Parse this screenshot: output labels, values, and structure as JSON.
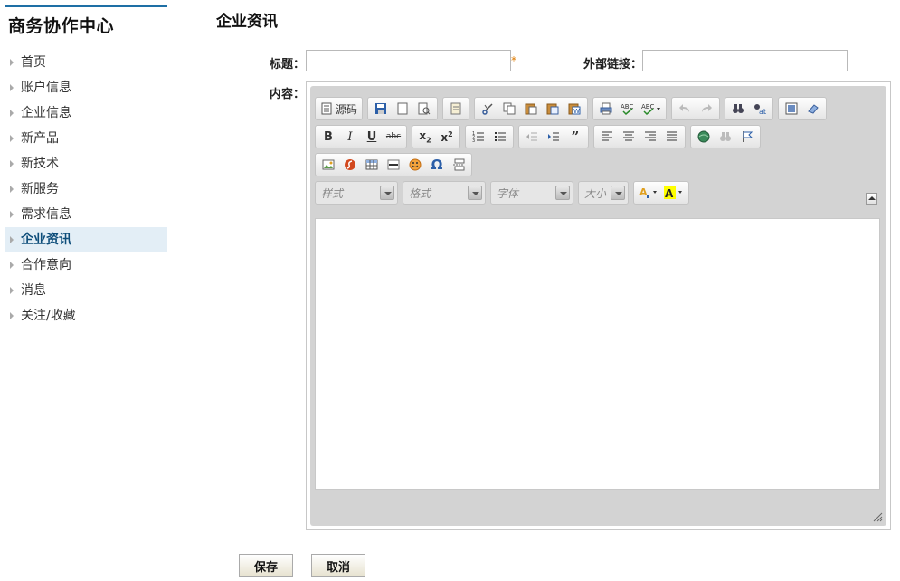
{
  "sidebar": {
    "title": "商务协作中心",
    "items": [
      {
        "label": "首页"
      },
      {
        "label": "账户信息"
      },
      {
        "label": "企业信息"
      },
      {
        "label": "新产品"
      },
      {
        "label": "新技术"
      },
      {
        "label": "新服务"
      },
      {
        "label": "需求信息"
      },
      {
        "label": "企业资讯",
        "active": true
      },
      {
        "label": "合作意向"
      },
      {
        "label": "消息"
      },
      {
        "label": "关注/收藏"
      }
    ]
  },
  "main": {
    "title": "企业资讯",
    "form": {
      "title_label": "标题：",
      "title_value": "",
      "required_mark": "*",
      "link_label": "外部链接：",
      "link_value": "",
      "content_label": "内容："
    },
    "editor": {
      "source_label": "源码",
      "combos": {
        "style": "样式",
        "format": "格式",
        "font": "字体",
        "size": "大小"
      },
      "icons": [
        "source-icon",
        "save-icon",
        "new-page-icon",
        "preview-icon",
        "templates-icon",
        "cut-icon",
        "copy-icon",
        "paste-icon",
        "paste-text-icon",
        "paste-word-icon",
        "print-icon",
        "spellcheck-icon",
        "scayt-icon",
        "undo-icon",
        "redo-icon",
        "find-icon",
        "replace-icon",
        "maximize-icon",
        "remove-format-icon",
        "bold-icon",
        "italic-icon",
        "underline-icon",
        "strike-icon",
        "subscript-icon",
        "superscript-icon",
        "numbered-list-icon",
        "bulleted-list-icon",
        "outdent-icon",
        "indent-icon",
        "blockquote-icon",
        "align-left-icon",
        "align-center-icon",
        "align-right-icon",
        "justify-icon",
        "link-icon",
        "unlink-icon",
        "anchor-icon",
        "image-icon",
        "flash-icon",
        "table-icon",
        "horizontal-rule-icon",
        "smiley-icon",
        "special-char-icon",
        "page-break-icon",
        "text-color-icon",
        "bg-color-icon"
      ]
    },
    "buttons": {
      "save": "保存",
      "cancel": "取消"
    }
  }
}
